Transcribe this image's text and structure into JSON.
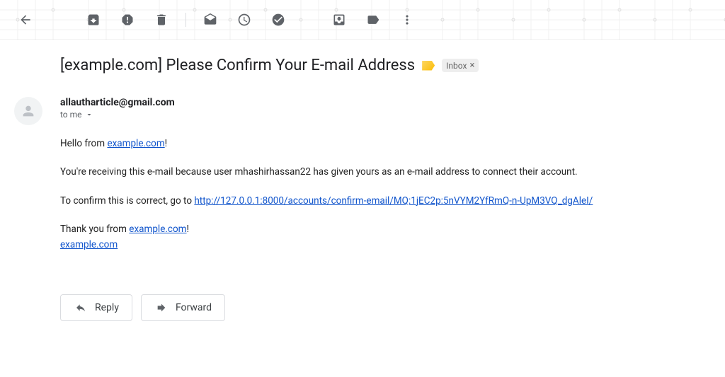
{
  "subject": "[example.com] Please Confirm Your E-mail Address",
  "label": "Inbox",
  "sender": "allautharticle@gmail.com",
  "recipient": "to me",
  "body": {
    "greeting_pre": "Hello from ",
    "greeting_link": "example.com",
    "greeting_post": "!",
    "line2": "You're receiving this e-mail because user mhashirhassan22 has given yours as an e-mail address to connect their account.",
    "confirm_pre": "To confirm this is correct, go to ",
    "confirm_link": "http://127.0.0.1:8000/accounts/confirm-email/MQ:1jEC2p:5nVYM2YfRmQ-n-UpM3VQ_dgAleI/",
    "thanks_pre": "Thank you from ",
    "thanks_link": "example.com",
    "thanks_post": "!",
    "footer_link": "example.com"
  },
  "buttons": {
    "reply": "Reply",
    "forward": "Forward"
  }
}
